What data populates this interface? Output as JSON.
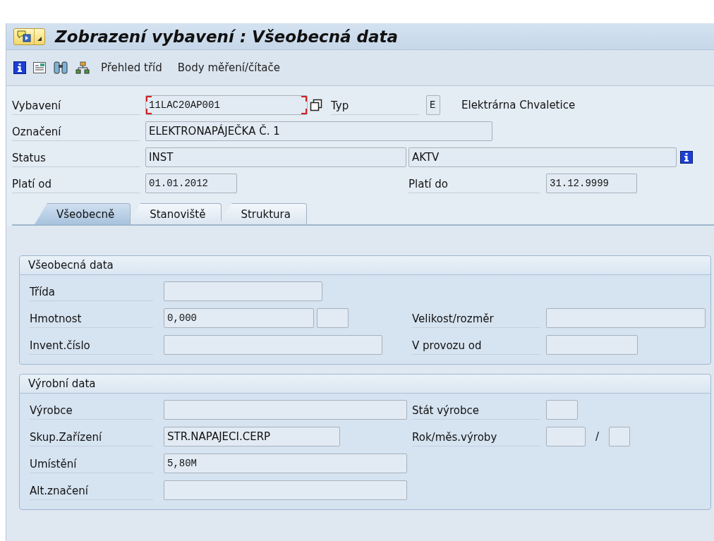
{
  "title_bar": {
    "title": "Zobrazení vybavení : Všeobecná data"
  },
  "toolbar": {
    "buttons": [
      "Přehled tříd",
      "Body měření/čítače"
    ]
  },
  "header": {
    "equipment": {
      "label": "Vybavení",
      "value": "11LAC20AP001",
      "focused": true
    },
    "type": {
      "label": "Typ",
      "value": "E",
      "text": "Elektrárna Chvaletice"
    },
    "description": {
      "label": "Označení",
      "value": "ELEKTRONAPÁJEČKA Č. 1"
    },
    "status": {
      "label": "Status",
      "value": "INST",
      "value_2": "AKTV"
    },
    "valid_from": {
      "label": "Platí od",
      "value": "01.01.2012"
    },
    "valid_to": {
      "label": "Platí do",
      "value": "31.12.9999"
    }
  },
  "tabs": [
    {
      "label": "Všeobecně",
      "selected": true
    },
    {
      "label": "Stanoviště",
      "selected": false
    },
    {
      "label": "Struktura",
      "selected": false
    }
  ],
  "general_data": {
    "title": "Všeobecná data",
    "class": {
      "label": "Třída"
    },
    "weight": {
      "label": "Hmotnost",
      "value": "0,000"
    },
    "size": {
      "label": "Velikost/rozměr"
    },
    "inventory_number": {
      "label": "Invent.číslo"
    },
    "start_up": {
      "label": "V provozu od"
    }
  },
  "manufacturer_data": {
    "title": "Výrobní data",
    "manufacturer": {
      "label": "Výrobce"
    },
    "country": {
      "label": "Stát výrobce"
    },
    "group": {
      "label": "Skup.Zařízení",
      "value": "STR.NAPAJECI.CERP"
    },
    "year_month": {
      "label": "Rok/měs.výroby",
      "separator": "/"
    },
    "location": {
      "label": "Umístění",
      "value": "5,80M"
    },
    "alt_label": {
      "label": "Alt.značení"
    }
  }
}
